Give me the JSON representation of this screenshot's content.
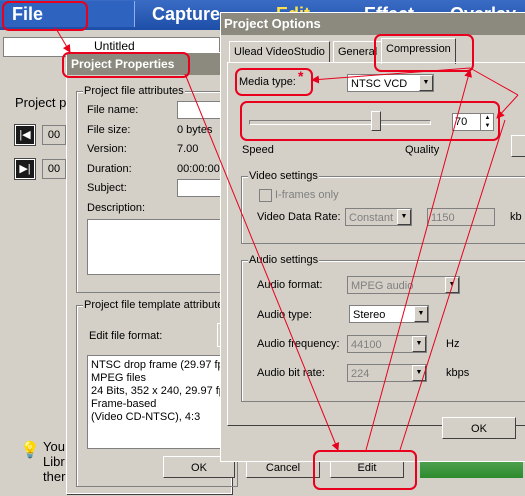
{
  "menubar": {
    "file": "File",
    "capture": "Capture",
    "edit": "Edit",
    "effect": "Effect",
    "overlay": "Overlay"
  },
  "background": {
    "title_value": "Untitled",
    "project_label": "Project p",
    "time_box_1": "00",
    "time_box_2": "00",
    "hint_line_1": "You",
    "hint_line_2": "Libr",
    "hint_line_3": "ther"
  },
  "project_properties": {
    "title": "Project Properties",
    "attributes_group": "Project file attributes",
    "file_name_label": "File name:",
    "file_size_label": "File size:",
    "file_size_value": "0 bytes",
    "version_label": "Version:",
    "version_value": "7.00",
    "duration_label": "Duration:",
    "duration_value": "00:00:00",
    "subject_label": "Subject:",
    "description_label": "Description:",
    "template_group": "Project file template attribute",
    "edit_file_format_label": "Edit file format:",
    "template_lines": [
      "NTSC drop frame (29.97 fp",
      "MPEG files",
      "24 Bits, 352 x 240, 29.97 fp",
      "Frame-based",
      "(Video CD-NTSC),  4:3"
    ],
    "ok_button": "OK",
    "cancel_button": "Cancel",
    "edit_button": "Edit"
  },
  "project_options": {
    "title": "Project Options",
    "tabs": [
      "Ulead VideoStudio",
      "General",
      "Compression"
    ],
    "media_type_label": "Media type:",
    "media_type_value": "NTSC VCD",
    "quality_value": "70",
    "quality_level": 0.7,
    "speed_label": "Speed",
    "quality_label": "Quality",
    "video_settings_group": "Video settings",
    "iframes_only_label": "I-frames only",
    "video_data_rate_label": "Video Data Rate:",
    "video_data_rate_mode": "Constant",
    "video_data_rate_value": "1150",
    "video_data_rate_unit": "kb",
    "audio_settings_group": "Audio settings",
    "audio_format_label": "Audio format:",
    "audio_format_value": "MPEG audio",
    "audio_type_label": "Audio type:",
    "audio_type_value": "Stereo",
    "audio_frequency_label": "Audio frequency:",
    "audio_frequency_value": "44100",
    "audio_frequency_unit": "Hz",
    "audio_bit_rate_label": "Audio bit rate:",
    "audio_bit_rate_value": "224",
    "audio_bit_rate_unit": "kbps",
    "ok_button": "OK"
  },
  "annotation": {
    "star": "*",
    "color": "#e8001c"
  }
}
